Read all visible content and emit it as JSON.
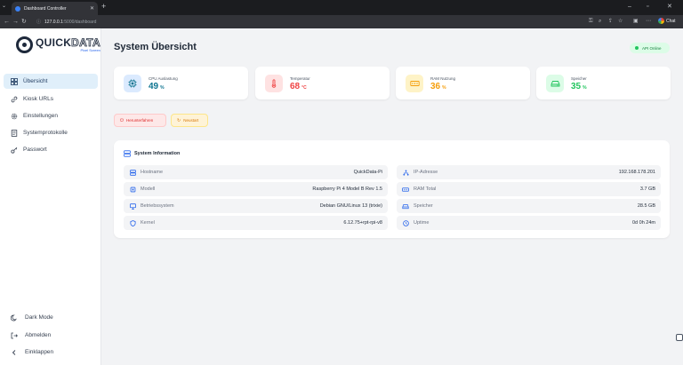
{
  "browser": {
    "tab_title": "Dashboard Controller",
    "url_host": "127.0.0.1",
    "url_path": ":5000/dashboard",
    "chat_label": "Chat"
  },
  "sidebar": {
    "logo_main": "QUICK",
    "logo_accent": "DATA",
    "logo_sub": "Pixel Screen",
    "items": [
      {
        "label": "Übersicht",
        "icon": "grid-icon"
      },
      {
        "label": "Kiosk URLs",
        "icon": "link-icon"
      },
      {
        "label": "Einstellungen",
        "icon": "gear-icon"
      },
      {
        "label": "Systemprotokolle",
        "icon": "document-icon"
      },
      {
        "label": "Passwort",
        "icon": "key-icon"
      }
    ],
    "bottom": {
      "dark_mode": "Dark Mode",
      "logout": "Abmelden",
      "collapse": "Einklappen"
    }
  },
  "header": {
    "title": "System Übersicht",
    "status_badge": "API Online"
  },
  "stats": [
    {
      "label": "CPU Auslastung",
      "value": "49",
      "unit": "%",
      "color": "#0e7490",
      "bg": "#dbeafe",
      "icon": "cpu-icon"
    },
    {
      "label": "Temperatur",
      "value": "68",
      "unit": "°C",
      "color": "#ef4444",
      "bg": "#fee2e2",
      "icon": "thermometer-icon"
    },
    {
      "label": "RAM Nutzung",
      "value": "36",
      "unit": "%",
      "color": "#f59e0b",
      "bg": "#fef3c7",
      "icon": "memory-icon"
    },
    {
      "label": "Speicher",
      "value": "35",
      "unit": "%",
      "color": "#22c55e",
      "bg": "#dcfce7",
      "icon": "drive-icon"
    }
  ],
  "actions": {
    "shutdown": "Herunterfahren",
    "restart": "Neustart"
  },
  "system_info": {
    "title": "System Information",
    "left": [
      {
        "label": "Hostname",
        "value": "QuickData-Pi",
        "icon": "server-icon"
      },
      {
        "label": "Modell",
        "value": "Raspberry Pi 4 Model B Rev 1.5",
        "icon": "chip-icon"
      },
      {
        "label": "Betriebssystem",
        "value": "Debian GNU/Linux 13 (trixie)",
        "icon": "monitor-icon"
      },
      {
        "label": "Kernel",
        "value": "6.12.75+rpt-rpi-v8",
        "icon": "shield-icon"
      }
    ],
    "right": [
      {
        "label": "IP-Adresse",
        "value": "192.168.178.201",
        "icon": "network-icon"
      },
      {
        "label": "RAM Total",
        "value": "3.7 GB",
        "icon": "memory-icon"
      },
      {
        "label": "Speicher",
        "value": "28.5 GB",
        "icon": "drive-icon"
      },
      {
        "label": "Uptime",
        "value": "0d 0h 24m",
        "icon": "clock-icon"
      }
    ]
  },
  "colors": {
    "accent": "#2563eb",
    "active_bg": "#e0effa",
    "online": "#22c55e"
  }
}
